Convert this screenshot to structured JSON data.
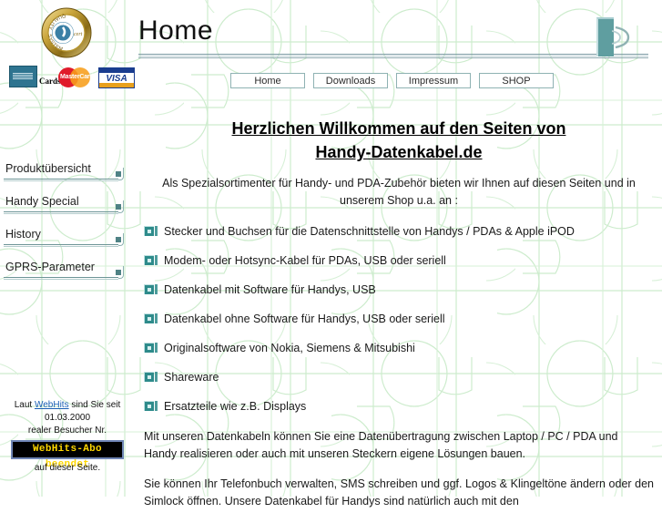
{
  "header": {
    "title": "Home",
    "seal_icon": "quality-seal-icon",
    "seal_text": "QUALITY SYSTEM",
    "deco_icon": "decorative-swoosh-icon"
  },
  "payment_logos": [
    {
      "name": "american-express-logo",
      "label": "Cards"
    },
    {
      "name": "mastercard-logo",
      "label": "MasterCard"
    },
    {
      "name": "visa-logo",
      "label": "VISA"
    }
  ],
  "topnav": {
    "items": [
      {
        "label": "Home"
      },
      {
        "label": "Downloads"
      },
      {
        "label": "Impressum"
      },
      {
        "label": "SHOP"
      }
    ]
  },
  "sidebar": {
    "items": [
      {
        "label": "Produktübersicht"
      },
      {
        "label": "Handy Special"
      },
      {
        "label": "History"
      },
      {
        "label": "GPRS-Parameter"
      }
    ]
  },
  "main": {
    "heading_line1": "Herzlichen Willkommen auf den Seiten von",
    "heading_line2": "Handy-Datenkabel.de",
    "intro": "Als Spezialsortimenter für Handy- und PDA-Zubehör bieten wir Ihnen auf diesen Seiten und in unserem Shop u.a. an :",
    "features": [
      "Stecker und Buchsen für die Datenschnittstelle von Handys / PDAs & Apple iPOD",
      "Modem- oder Hotsync-Kabel für PDAs, USB oder seriell",
      "Datenkabel mit Software für Handys, USB",
      "Datenkabel ohne Software für Handys, USB oder seriell",
      "Originalsoftware von Nokia, Siemens & Mitsubishi",
      "Shareware",
      "Ersatzteile wie z.B. Displays"
    ],
    "paragraph1": "Mit unseren Datenkabeln können Sie eine Datenübertragung zwischen Laptop / PC / PDA und Handy realisieren oder auch mit unseren Steckern eigene Lösungen bauen.",
    "paragraph2": "Sie können Ihr Telefonbuch verwalten, SMS schreiben und ggf. Logos & Klingeltöne ändern oder den Simlock öffnen. Unsere Datenkabel für Handys sind natürlich auch mit den"
  },
  "webhits": {
    "line1_pre": "Laut ",
    "link": "WebHits",
    "line1_post": " sind Sie seit",
    "date": "01.03.2000",
    "line3": "realer Besucher Nr.",
    "counter": "WebHits-Abo beendet",
    "line4": "auf dieser Seite."
  },
  "colors": {
    "accent_teal": "#2e8b8b",
    "nav_border": "#8fb2b3",
    "pattern_green": "#cdeccd",
    "counter_text": "#ffd700",
    "link_blue": "#1a5fb4"
  }
}
